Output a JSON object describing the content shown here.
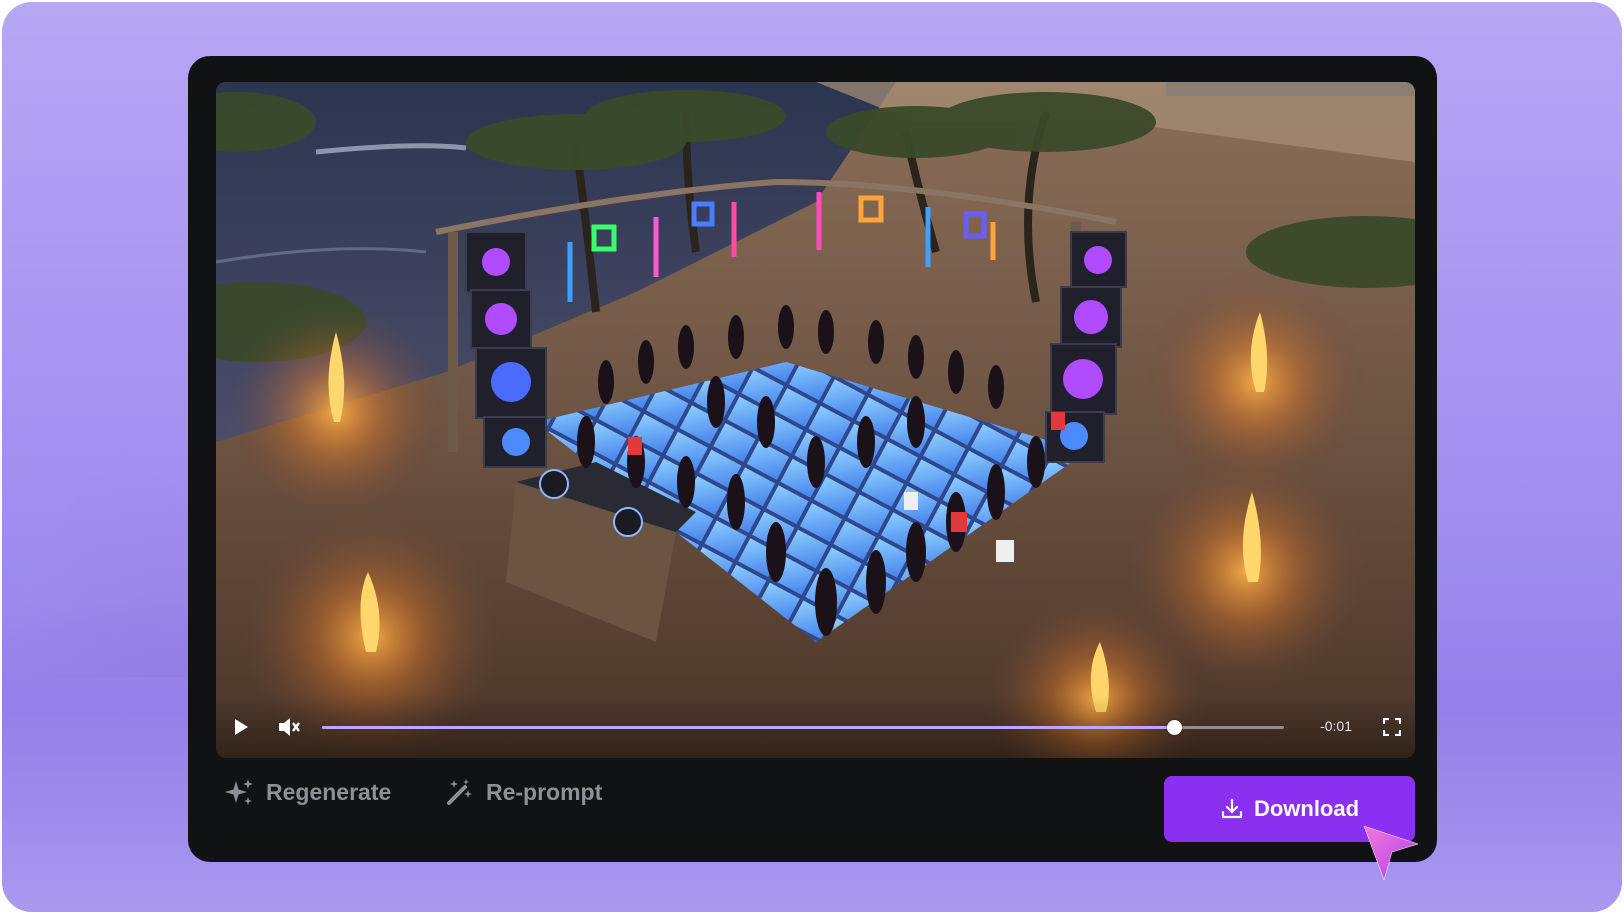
{
  "player": {
    "time_remaining": "-0:01",
    "progress": 0.8853,
    "muted": true,
    "video_description": "Aerial night scene of a beach party with a glowing blue dance floor, DJ booth, speaker towers, neon lights and bonfires"
  },
  "actions": {
    "regenerate_label": "Regenerate",
    "reprompt_label": "Re-prompt"
  },
  "download": {
    "label": "Download"
  },
  "colors": {
    "accent": "#8b2ff0",
    "card_bg": "#111214",
    "backdrop": "#a897f2",
    "progress_fill": "#b9a6ff",
    "muted_text": "#8f9096"
  },
  "icons": [
    "play-icon",
    "mute-icon",
    "fullscreen-icon",
    "sparkle-icon",
    "magic-wand-icon",
    "download-icon",
    "cursor-pointer-icon"
  ]
}
